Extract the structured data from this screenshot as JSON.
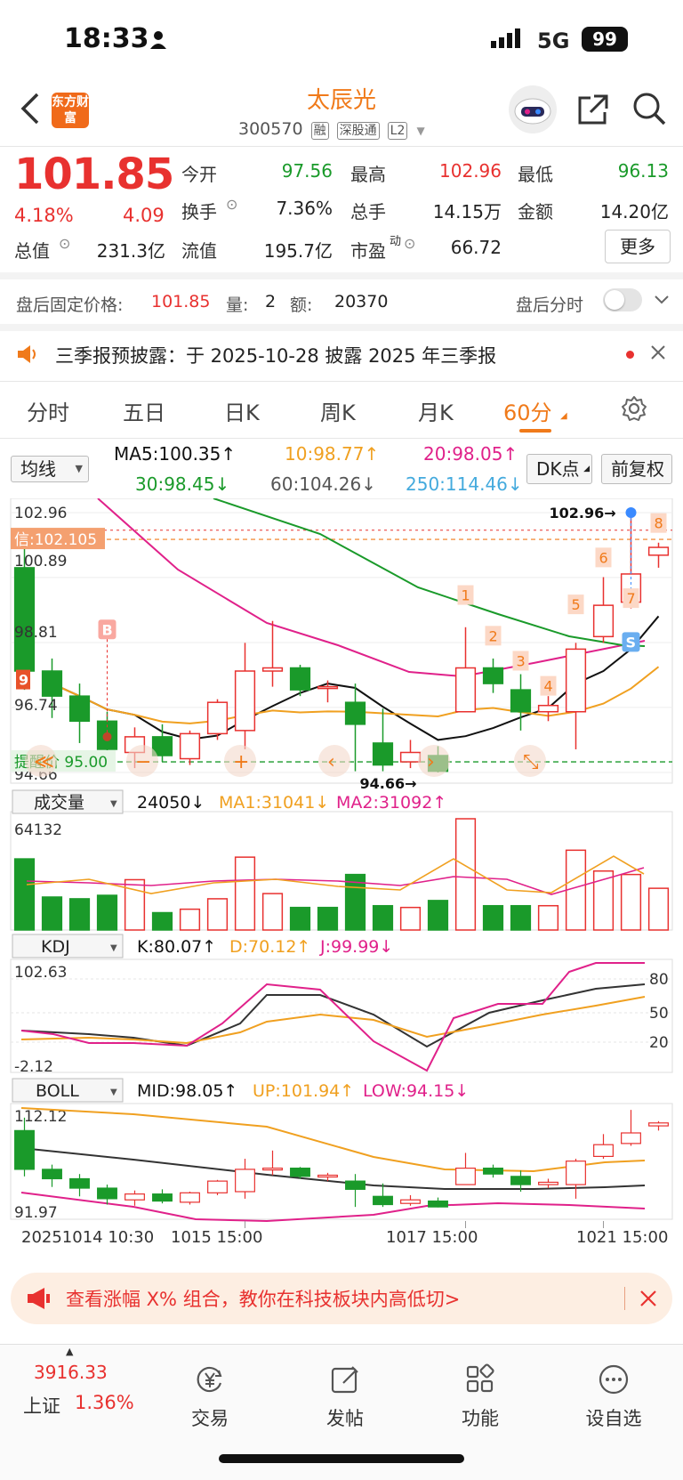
{
  "status_bar": {
    "time": "18:33",
    "network": "5G",
    "battery": "99"
  },
  "header": {
    "logo_text": "东方财富",
    "stock_name": "太辰光",
    "stock_code": "300570",
    "tags": [
      "融",
      "深股通",
      "L2"
    ]
  },
  "quote": {
    "price": "101.85",
    "change_pct": "4.18%",
    "change": "4.09",
    "rows": [
      [
        {
          "label": "今开",
          "value": "97.56",
          "color": "green"
        },
        {
          "label": "最高",
          "value": "102.96",
          "color": "red"
        },
        {
          "label": "最低",
          "value": "96.13",
          "color": "green"
        }
      ],
      [
        {
          "label": "换手",
          "value": "7.36%",
          "color": "plain"
        },
        {
          "label": "总手",
          "value": "14.15万",
          "color": "plain"
        },
        {
          "label": "金额",
          "value": "14.20亿",
          "color": "plain"
        }
      ],
      [
        {
          "label": "流值",
          "value": "195.7亿",
          "color": "plain"
        },
        {
          "label": "市盈",
          "value": "66.72",
          "color": "plain"
        }
      ]
    ],
    "total_value_label": "总值",
    "total_value": "231.3亿",
    "pe_sup": "动",
    "more_label": "更多"
  },
  "after_hours": {
    "label": "盘后固定价格:",
    "price": "101.85",
    "vol_label": "量:",
    "vol": "2",
    "amt_label": "额:",
    "amt": "20370",
    "toggle_label": "盘后分时"
  },
  "notice": {
    "text": "三季报预披露：于 2025-10-28 披露 2025 年三季报"
  },
  "tabs": {
    "items": [
      "分时",
      "五日",
      "日K",
      "周K",
      "月K",
      "60分"
    ],
    "active": 5
  },
  "indicators": {
    "ma_selector": "均线",
    "ma5": "MA5:100.35↑",
    "ma10": "10:98.77↑",
    "ma20": "20:98.05↑",
    "ma30": "30:98.45↓",
    "ma60": "60:104.26↓",
    "ma250": "250:114.46↓",
    "dk_label": "DK点",
    "fq_label": "前复权"
  },
  "main_chart": {
    "y_top": "102.96",
    "y_mid1": "100.89",
    "y_mid2": "98.81",
    "y_low": "96.74",
    "y_bottom": "94.66",
    "signal_label": "信:102.105",
    "stop_label": "提醒价 95.00",
    "high_marker": "102.96→",
    "low_marker": "94.66→",
    "buy_tag": "B",
    "sell_tag": "S",
    "nine_tag": "9",
    "count_tags": [
      "1",
      "2",
      "3",
      "4",
      "5",
      "6",
      "7",
      "8"
    ]
  },
  "chart_data": {
    "type": "candlestick",
    "candles": [
      {
        "o": 101.2,
        "c": 97.9,
        "h": 102.3,
        "l": 97.3
      },
      {
        "o": 97.9,
        "c": 97.1,
        "h": 98.3,
        "l": 96.4
      },
      {
        "o": 97.1,
        "c": 96.3,
        "h": 97.5,
        "l": 95.6
      },
      {
        "o": 96.3,
        "c": 95.4,
        "h": 96.6,
        "l": 94.9
      },
      {
        "o": 95.3,
        "c": 95.8,
        "h": 96.1,
        "l": 94.8
      },
      {
        "o": 95.8,
        "c": 95.2,
        "h": 96.2,
        "l": 95.0
      },
      {
        "o": 95.1,
        "c": 95.9,
        "h": 96.0,
        "l": 94.9
      },
      {
        "o": 95.9,
        "c": 96.9,
        "h": 97.0,
        "l": 95.7
      },
      {
        "o": 96.0,
        "c": 97.9,
        "h": 98.8,
        "l": 95.4
      },
      {
        "o": 97.9,
        "c": 98.0,
        "h": 99.5,
        "l": 97.4
      },
      {
        "o": 98.0,
        "c": 97.3,
        "h": 98.1,
        "l": 97.1
      },
      {
        "o": 97.4,
        "c": 97.4,
        "h": 97.6,
        "l": 96.9
      },
      {
        "o": 96.9,
        "c": 96.2,
        "h": 97.5,
        "l": 94.7
      },
      {
        "o": 95.6,
        "c": 94.9,
        "h": 96.7,
        "l": 94.7
      },
      {
        "o": 95.0,
        "c": 95.3,
        "h": 95.7,
        "l": 94.8
      },
      {
        "o": 95.2,
        "c": 94.7,
        "h": 95.5,
        "l": 94.66
      },
      {
        "o": 96.6,
        "c": 98.0,
        "h": 99.3,
        "l": 96.6
      },
      {
        "o": 98.0,
        "c": 97.5,
        "h": 98.3,
        "l": 97.2
      },
      {
        "o": 97.3,
        "c": 96.6,
        "h": 97.8,
        "l": 96.0
      },
      {
        "o": 96.6,
        "c": 96.8,
        "h": 97.1,
        "l": 96.3
      },
      {
        "o": 96.6,
        "c": 98.6,
        "h": 98.8,
        "l": 95.4
      },
      {
        "o": 99.0,
        "c": 100.0,
        "h": 100.9,
        "l": 98.8
      },
      {
        "o": 100.1,
        "c": 101.0,
        "h": 102.96,
        "l": 99.9
      },
      {
        "o": 101.6,
        "c": 101.85,
        "h": 102.0,
        "l": 101.2
      }
    ],
    "volume": {
      "title": "成交量",
      "value": "24050↓",
      "ma1": "MA1:31041↓",
      "ma2": "MA2:31092↑",
      "max_label": "64132",
      "values": [
        41000,
        19000,
        18000,
        20000,
        29000,
        10000,
        12000,
        18000,
        42000,
        21000,
        13000,
        13000,
        32000,
        14000,
        13000,
        17000,
        64132,
        14000,
        14000,
        14000,
        46000,
        34000,
        32000,
        24050
      ],
      "up": [
        0,
        0,
        0,
        0,
        1,
        0,
        1,
        1,
        1,
        1,
        0,
        0,
        0,
        0,
        1,
        0,
        1,
        0,
        0,
        1,
        1,
        1,
        1,
        1
      ]
    },
    "kdj": {
      "title": "KDJ",
      "k": "K:80.07↑",
      "d": "D:70.12↑",
      "j": "J:99.99↓",
      "max_label": "102.63",
      "min_label": "-2.12",
      "levels": [
        "80",
        "50",
        "20"
      ]
    },
    "boll": {
      "title": "BOLL",
      "mid": "MID:98.05↑",
      "up": "UP:101.94↑",
      "low": "LOW:94.15↓",
      "max_label": "112.12",
      "min_label": "91.97"
    },
    "x_labels": [
      "20251014 10:30",
      "1015 15:00",
      "1017 15:00",
      "1021 15:00"
    ]
  },
  "promo": {
    "text": "查看涨幅 X% 组合，教你在科技板块内高低切>"
  },
  "index": {
    "value": "3916.33",
    "name": "上证",
    "pct": "1.36%"
  },
  "bottom_nav": [
    "交易",
    "发帖",
    "功能",
    "设自选"
  ],
  "colors": {
    "red": "#e8312f",
    "green": "#1a9a2a",
    "orange": "#f07a1a",
    "magenta": "#e0218a"
  }
}
